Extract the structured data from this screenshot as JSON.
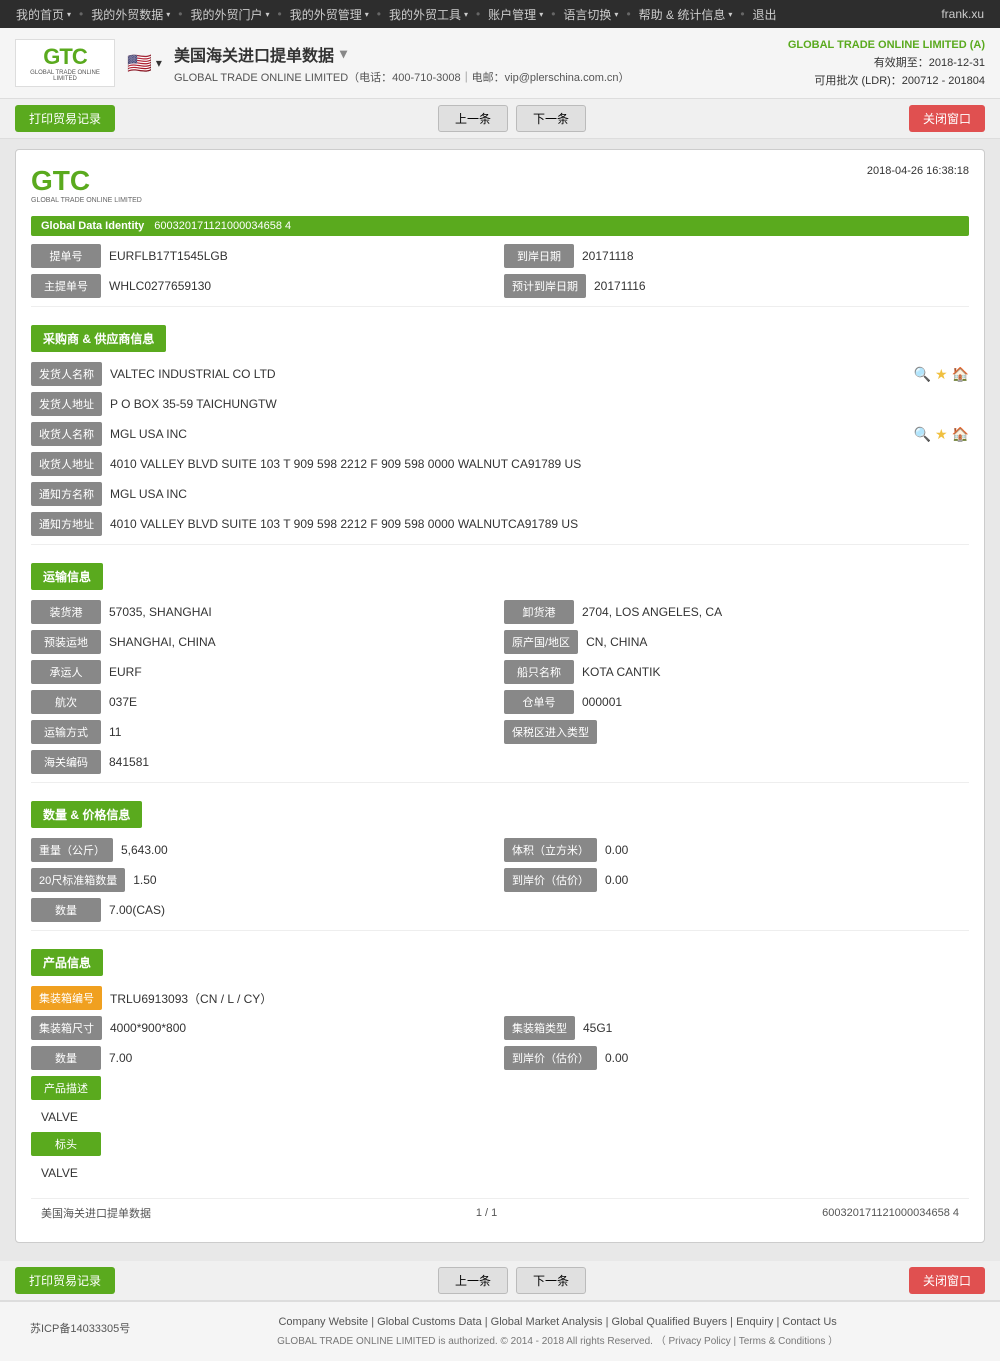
{
  "nav": {
    "items": [
      {
        "label": "我的首页",
        "hasArrow": true
      },
      {
        "label": "我的外贸数据",
        "hasArrow": true
      },
      {
        "label": "我的外贸门户",
        "hasArrow": true
      },
      {
        "label": "我的外贸管理",
        "hasArrow": true
      },
      {
        "label": "我的外贸工具",
        "hasArrow": true
      },
      {
        "label": "账户管理",
        "hasArrow": true
      },
      {
        "label": "语言切换",
        "hasArrow": true
      },
      {
        "label": "帮助 & 统计信息",
        "hasArrow": true
      },
      {
        "label": "退出",
        "hasArrow": false
      }
    ],
    "user": "frank.xu"
  },
  "header": {
    "title": "美国海关进口提单数据",
    "subtitle": "GLOBAL TRADE ONLINE LIMITED（电话：400-710-3008｜电邮：vip@plerschina.com.cn）",
    "company": "GLOBAL TRADE ONLINE LIMITED (A)",
    "valid_until": "有效期至：2018-12-31",
    "ldr": "可用批次 (LDR)：200712 - 201804"
  },
  "toolbar": {
    "print_label": "打印贸易记录",
    "prev_label": "上一条",
    "next_label": "下一条",
    "close_label": "关闭窗口"
  },
  "document": {
    "datetime": "2018-04-26  16:38:18",
    "global_data_identity_label": "Global Data Identity",
    "global_data_identity_value": "600320171121000034658 4",
    "fields": {
      "bill_no_label": "提单号",
      "bill_no_value": "EURFLB17T1545LGB",
      "arrival_date_label": "到岸日期",
      "arrival_date_value": "20171118",
      "master_bill_label": "主提单号",
      "master_bill_value": "WHLC0277659130",
      "estimated_arrival_label": "预计到岸日期",
      "estimated_arrival_value": "20171116"
    },
    "supplier_section": {
      "title": "采购商 & 供应商信息",
      "shipper_name_label": "发货人名称",
      "shipper_name_value": "VALTEC INDUSTRIAL CO LTD",
      "shipper_addr_label": "发货人地址",
      "shipper_addr_value": "P O BOX 35-59 TAICHUNGTW",
      "consignee_name_label": "收货人名称",
      "consignee_name_value": "MGL USA INC",
      "consignee_addr_label": "收货人地址",
      "consignee_addr_value": "4010 VALLEY BLVD SUITE 103 T 909 598 2212 F 909 598 0000 WALNUT CA91789 US",
      "notify_name_label": "通知方名称",
      "notify_name_value": "MGL USA INC",
      "notify_addr_label": "通知方地址",
      "notify_addr_value": "4010 VALLEY BLVD SUITE 103 T 909 598 2212 F 909 598 0000 WALNUTCA91789 US"
    },
    "transport_section": {
      "title": "运输信息",
      "loading_port_label": "装货港",
      "loading_port_value": "57035, SHANGHAI",
      "discharge_port_label": "卸货港",
      "discharge_port_value": "2704, LOS ANGELES, CA",
      "origin_place_label": "预装运地",
      "origin_place_value": "SHANGHAI, CHINA",
      "origin_country_label": "原产国/地区",
      "origin_country_value": "CN, CHINA",
      "carrier_label": "承运人",
      "carrier_value": "EURF",
      "vessel_label": "船只名称",
      "vessel_value": "KOTA CANTIK",
      "voyage_label": "航次",
      "voyage_value": "037E",
      "bill_container_label": "仓单号",
      "bill_container_value": "000001",
      "transport_mode_label": "运输方式",
      "transport_mode_value": "11",
      "ftz_type_label": "保税区进入类型",
      "ftz_type_value": "",
      "customs_code_label": "海关编码",
      "customs_code_value": "841581"
    },
    "quantity_section": {
      "title": "数量 & 价格信息",
      "weight_label": "重量（公斤）",
      "weight_value": "5,643.00",
      "volume_label": "体积（立方米）",
      "volume_value": "0.00",
      "container20_label": "20尺标准箱数量",
      "container20_value": "1.50",
      "arrival_price_label": "到岸价（估价）",
      "arrival_price_value": "0.00",
      "quantity_label": "数量",
      "quantity_value": "7.00(CAS)"
    },
    "product_section": {
      "title": "产品信息",
      "container_no_label": "集装箱编号",
      "container_no_value": "TRLU6913093（CN / L / CY）",
      "container_size_label": "集装箱尺寸",
      "container_size_value": "4000*900*800",
      "container_type_label": "集装箱类型",
      "container_type_value": "45G1",
      "quantity2_label": "数量",
      "quantity2_value": "7.00",
      "arrival_price2_label": "到岸价（估价）",
      "arrival_price2_value": "0.00",
      "product_desc_label": "产品描述",
      "product_desc_value": "VALVE",
      "marks_label": "标头",
      "marks_value": "VALVE"
    },
    "pagination": {
      "left": "美国海关进口提单数据",
      "middle": "1 / 1",
      "right": "600320171121000034658 4"
    }
  },
  "footer": {
    "links": [
      "Company Website",
      "Global Customs Data",
      "Global Market Analysis",
      "Global Qualified Buyers",
      "Enquiry",
      "Contact Us"
    ],
    "copyright": "GLOBAL TRADE ONLINE LIMITED is authorized. © 2014 - 2018 All rights Reserved.  （ Privacy Policy | Terms & Conditions ）",
    "icp": "苏ICP备14033305号"
  }
}
